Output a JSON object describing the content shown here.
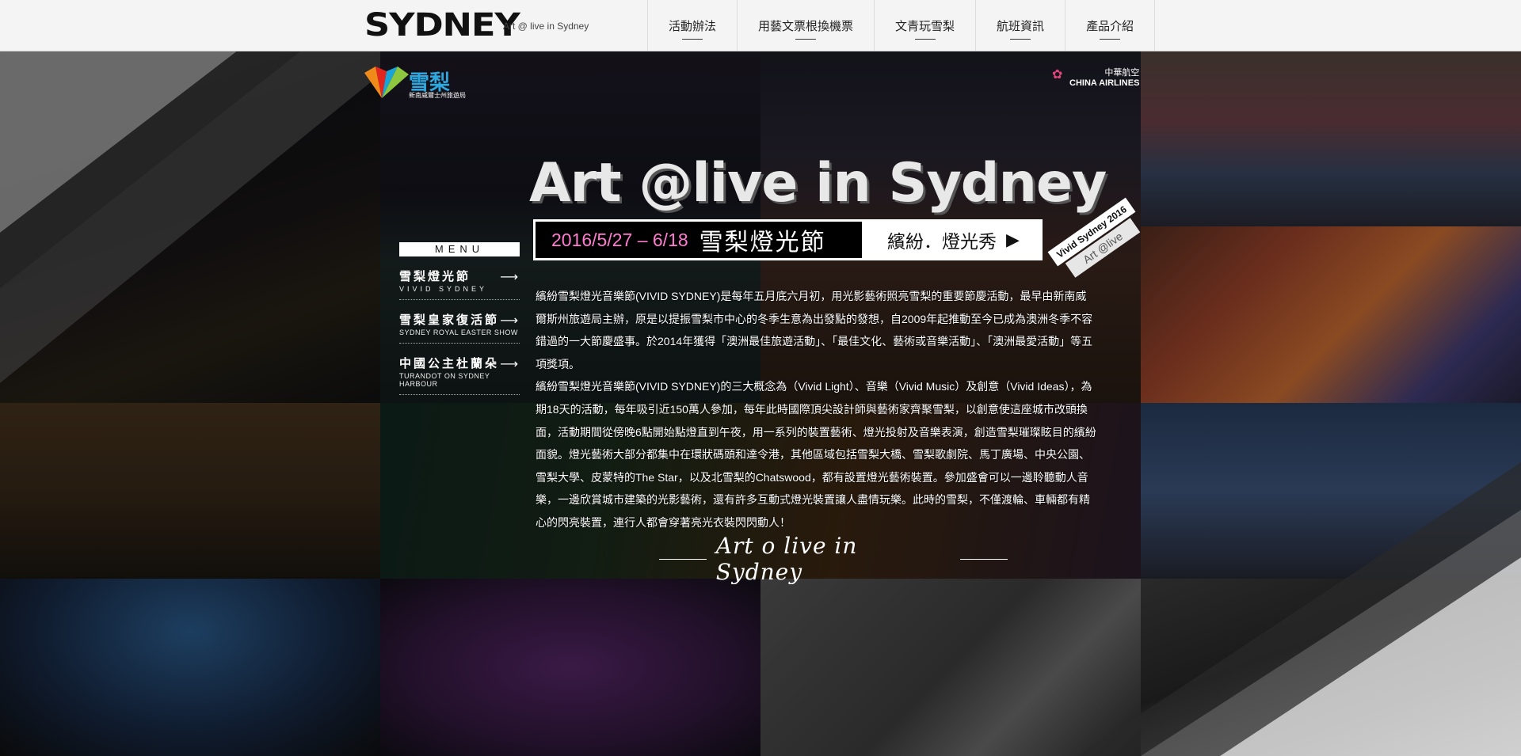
{
  "header": {
    "logo": "SYDNEY",
    "tagline": "Art @ live in Sydney",
    "nav": [
      "活動辦法",
      "用藝文票根換機票",
      "文青玩雪梨",
      "航班資訊",
      "產品介紹"
    ]
  },
  "sponsors": {
    "nsw_name": "雪梨",
    "nsw_sub": "新南威爾士州旅遊局",
    "airline_zh": "中華航空",
    "airline_en": "CHINA AIRLINES"
  },
  "hero": {
    "title": "Art @live in Sydney",
    "date": "2016/5/27 – 6/18",
    "festival": "雪梨燈光節",
    "show": "繽紛．燈光秀",
    "tag_line1": "Vivid Sydney 2016",
    "tag_line2": "Art @live"
  },
  "menu": {
    "title": "MENU",
    "items": [
      {
        "zh": "雪梨燈光節",
        "en": "VIVID SYDNEY"
      },
      {
        "zh": "雪梨皇家復活節",
        "en": "SYDNEY ROYAL EASTER SHOW"
      },
      {
        "zh": "中國公主杜蘭朵",
        "en": "TURANDOT ON SYDNEY HARBOUR"
      }
    ]
  },
  "content": {
    "paragraph1": "繽紛雪梨燈光音樂節(VIVID SYDNEY)是每年五月底六月初，用光影藝術照亮雪梨的重要節慶活動，最早由新南威爾斯州旅遊局主辦，原是以提振雪梨市中心的冬季生意為出發點的發想，自2009年起推動至今已成為澳洲冬季不容錯過的一大節慶盛事。於2014年獲得「澳洲最佳旅遊活動」、「最佳文化、藝術或音樂活動」、「澳洲最愛活動」等五項獎項。",
    "paragraph2": "繽紛雪梨燈光音樂節(VIVID SYDNEY)的三大概念為（Vivid Light）、音樂（Vivid Music）及創意（Vivid Ideas），為期18天的活動，每年吸引近150萬人參加，每年此時國際頂尖設計師與藝術家齊聚雪梨，以創意使這座城市改頭換面，活動期間從傍晚6點開始點燈直到午夜，用一系列的裝置藝術、燈光投射及音樂表演，創造雪梨璀璨眩目的繽紛面貌。燈光藝術大部分都集中在環狀碼頭和達令港，其他區域包括雪梨大橋、雪梨歌劇院、馬丁廣場、中央公園、雪梨大學、皮蒙特的The Star，以及北雪梨的Chatswood，都有設置燈光藝術裝置。參加盛會可以一邊聆聽動人音樂，一邊欣賞城市建築的光影藝術，還有許多互動式燈光裝置讓人盡情玩樂。此時的雪梨，不僅渡輪、車輛都有精心的閃亮裝置，連行人都會穿著亮光衣裝閃閃動人！",
    "signature": "Art o live in Sydney"
  }
}
